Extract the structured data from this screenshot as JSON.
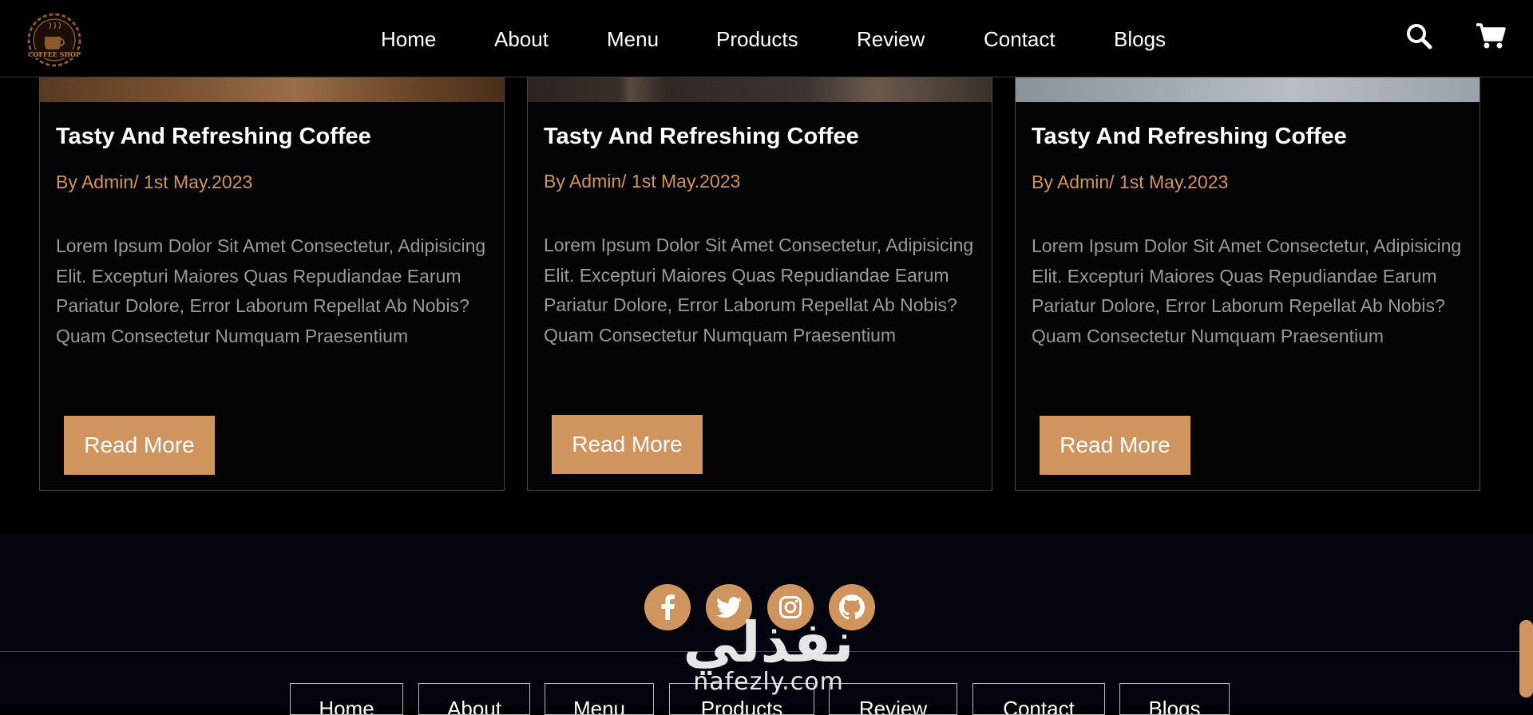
{
  "brand": {
    "logo_text": "COFFEE SHOP"
  },
  "nav": {
    "items": [
      {
        "label": "Home"
      },
      {
        "label": "About"
      },
      {
        "label": "Menu"
      },
      {
        "label": "Products"
      },
      {
        "label": "Review"
      },
      {
        "label": "Contact"
      },
      {
        "label": "Blogs"
      }
    ]
  },
  "header_icons": [
    "search-icon",
    "shopping-cart-icon"
  ],
  "blogs": [
    {
      "title": "Tasty And Refreshing Coffee",
      "meta": "By Admin/ 1st May.2023",
      "body": "Lorem Ipsum Dolor Sit Amet Consectetur, Adipisicing Elit. Excepturi Maiores Quas Repudiandae Earum Pariatur Dolore, Error Laborum Repellat Ab Nobis? Quam Consectetur Numquam Praesentium",
      "button": "Read More"
    },
    {
      "title": "Tasty And Refreshing Coffee",
      "meta": "By Admin/ 1st May.2023",
      "body": "Lorem Ipsum Dolor Sit Amet Consectetur, Adipisicing Elit. Excepturi Maiores Quas Repudiandae Earum Pariatur Dolore, Error Laborum Repellat Ab Nobis? Quam Consectetur Numquam Praesentium",
      "button": "Read More"
    },
    {
      "title": "Tasty And Refreshing Coffee",
      "meta": "By Admin/ 1st May.2023",
      "body": "Lorem Ipsum Dolor Sit Amet Consectetur, Adipisicing Elit. Excepturi Maiores Quas Repudiandae Earum Pariatur Dolore, Error Laborum Repellat Ab Nobis? Quam Consectetur Numquam Praesentium",
      "button": "Read More"
    }
  ],
  "footer": {
    "social": [
      "facebook-icon",
      "twitter-icon",
      "instagram-icon",
      "github-icon"
    ]
  },
  "watermark": {
    "arabic": "نفذلي",
    "latin": "nafezly.com"
  },
  "colors": {
    "accent": "#d0955e",
    "meta_text": "#cf955f",
    "background": "#000000",
    "footer_bg": "#03040e"
  }
}
